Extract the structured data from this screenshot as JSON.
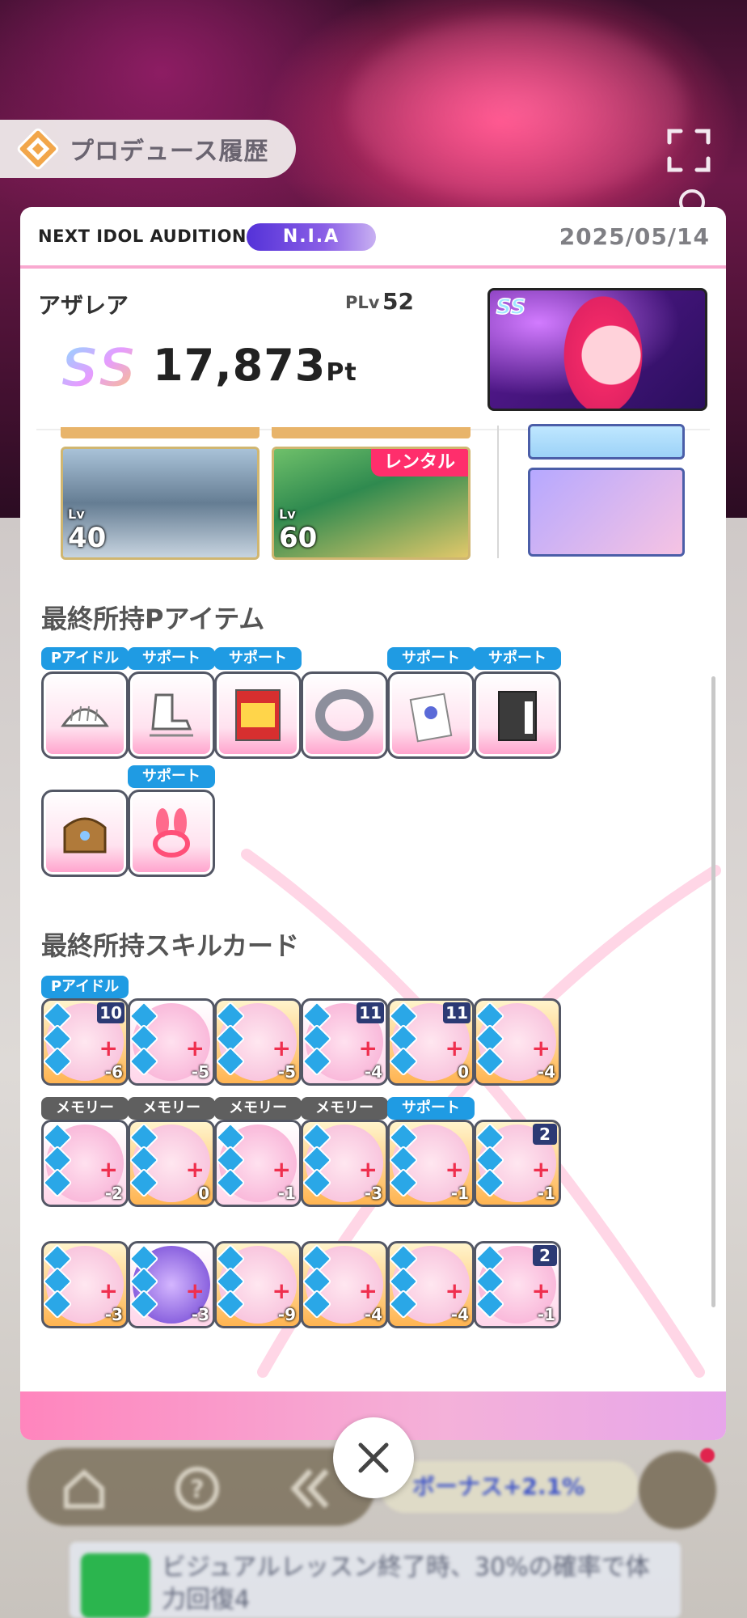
{
  "header": {
    "history_title": "プロデュース履歴"
  },
  "panel": {
    "event_label": "NEXT IDOL AUDITION",
    "event_badge": "N.I.A",
    "date": "2025/05/14",
    "character_name": "アザレア",
    "plv_label": "PLv",
    "plv_value": "52",
    "rank": "SS",
    "score": "17,873",
    "score_unit": "Pt",
    "portrait_rank": "SS"
  },
  "deck": {
    "cards": [
      {
        "level_label": "Lv",
        "level": "40",
        "rental": ""
      },
      {
        "level_label": "Lv",
        "level": "60",
        "rental": "レンタル"
      }
    ]
  },
  "p_items": {
    "title": "最終所持Pアイテム",
    "items": [
      {
        "tag": "Pアイドル",
        "icon": "comb-icon"
      },
      {
        "tag": "サポート",
        "icon": "skate-icon"
      },
      {
        "tag": "サポート",
        "icon": "ramen-poster-icon"
      },
      {
        "tag": "",
        "icon": "audition-band-icon"
      },
      {
        "tag": "サポート",
        "icon": "flower-card-icon"
      },
      {
        "tag": "サポート",
        "icon": "book-icon"
      },
      {
        "tag": "",
        "icon": "bag-charm-icon"
      },
      {
        "tag": "サポート",
        "icon": "balloon-bunny-icon"
      }
    ]
  },
  "skill_cards": {
    "title": "最終所持スキルカード",
    "cards": [
      {
        "tag": "Pアイドル",
        "cost": "10",
        "stamina": "-6"
      },
      {
        "tag": "",
        "cost": "",
        "stamina": "-5"
      },
      {
        "tag": "",
        "cost": "",
        "stamina": "-5"
      },
      {
        "tag": "",
        "cost": "11",
        "stamina": "-4"
      },
      {
        "tag": "",
        "cost": "11",
        "stamina": "0"
      },
      {
        "tag": "",
        "cost": "",
        "stamina": "-4"
      },
      {
        "tag": "メモリー",
        "cost": "",
        "stamina": "-2"
      },
      {
        "tag": "メモリー",
        "cost": "",
        "stamina": "0"
      },
      {
        "tag": "メモリー",
        "cost": "",
        "stamina": "-1"
      },
      {
        "tag": "メモリー",
        "cost": "",
        "stamina": "-3"
      },
      {
        "tag": "サポート",
        "cost": "",
        "stamina": "-1"
      },
      {
        "tag": "",
        "cost": "2",
        "stamina": "-1"
      },
      {
        "tag": "",
        "cost": "",
        "stamina": "-3"
      },
      {
        "tag": "",
        "cost": "",
        "stamina": "-3"
      },
      {
        "tag": "",
        "cost": "",
        "stamina": "-9"
      },
      {
        "tag": "",
        "cost": "",
        "stamina": "-4"
      },
      {
        "tag": "",
        "cost": "",
        "stamina": "-4"
      },
      {
        "tag": "",
        "cost": "2",
        "stamina": "-1"
      }
    ]
  },
  "background": {
    "bonus_text": "ボーナス+2.1%",
    "info_text": "ビジュアルレッスン終了時、30%の確率で体力回復4"
  },
  "colors": {
    "accent_pink": "#ff2e6c",
    "nia_purple": "#5432d8",
    "support_blue": "#1f9be3",
    "memory_gray": "#5f5f5f"
  }
}
